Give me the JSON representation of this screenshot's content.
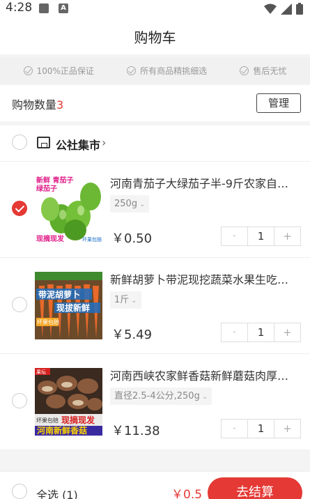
{
  "status_bar": {
    "time": "4:28",
    "a_icon": "A"
  },
  "header": {
    "title": "购物车"
  },
  "guarantees": [
    {
      "label": "100%正品保证"
    },
    {
      "label": "所有商品精挑细选"
    },
    {
      "label": "售后无忧"
    }
  ],
  "cart": {
    "count_label": "购物数量",
    "count": "3",
    "manage_label": "管理"
  },
  "shop": {
    "name": "公社集市",
    "chevron": "›"
  },
  "items": [
    {
      "title": "河南青茄子大绿茄子半-9斤农家自…",
      "spec": "250g",
      "price": "￥0.50",
      "qty": "1",
      "selected": true,
      "img_text": {
        "line1": "新鲜 青茄子",
        "line2": "绿茄子",
        "tag": "现摘现发",
        "badge": "坏果包赔"
      }
    },
    {
      "title": "新鲜胡萝卜带泥现挖蔬菜水果生吃…",
      "spec": "1斤",
      "price": "￥5.49",
      "qty": "1",
      "selected": false,
      "img_text": {
        "line1": "带泥胡萝卜",
        "line2": "现拔新鲜",
        "tag": "坏果包赔"
      }
    },
    {
      "title": "河南西峡农家鲜香菇新鲜蘑菇肉厚…",
      "spec": "直径2.5-4公分,250g",
      "price": "￥11.38",
      "qty": "1",
      "selected": false,
      "img_text": {
        "corner": "果坛",
        "badge": "坏果包赔",
        "line1": "现摘现发",
        "line2": "河南新鲜香菇"
      }
    }
  ],
  "stepper": {
    "minus": "-",
    "plus": "+"
  },
  "footer": {
    "select_all_label": "全选 (1)",
    "total": "￥0.5",
    "checkout_label": "去结算"
  },
  "colors": {
    "accent": "#e53935",
    "background": "#f4f4f4"
  }
}
